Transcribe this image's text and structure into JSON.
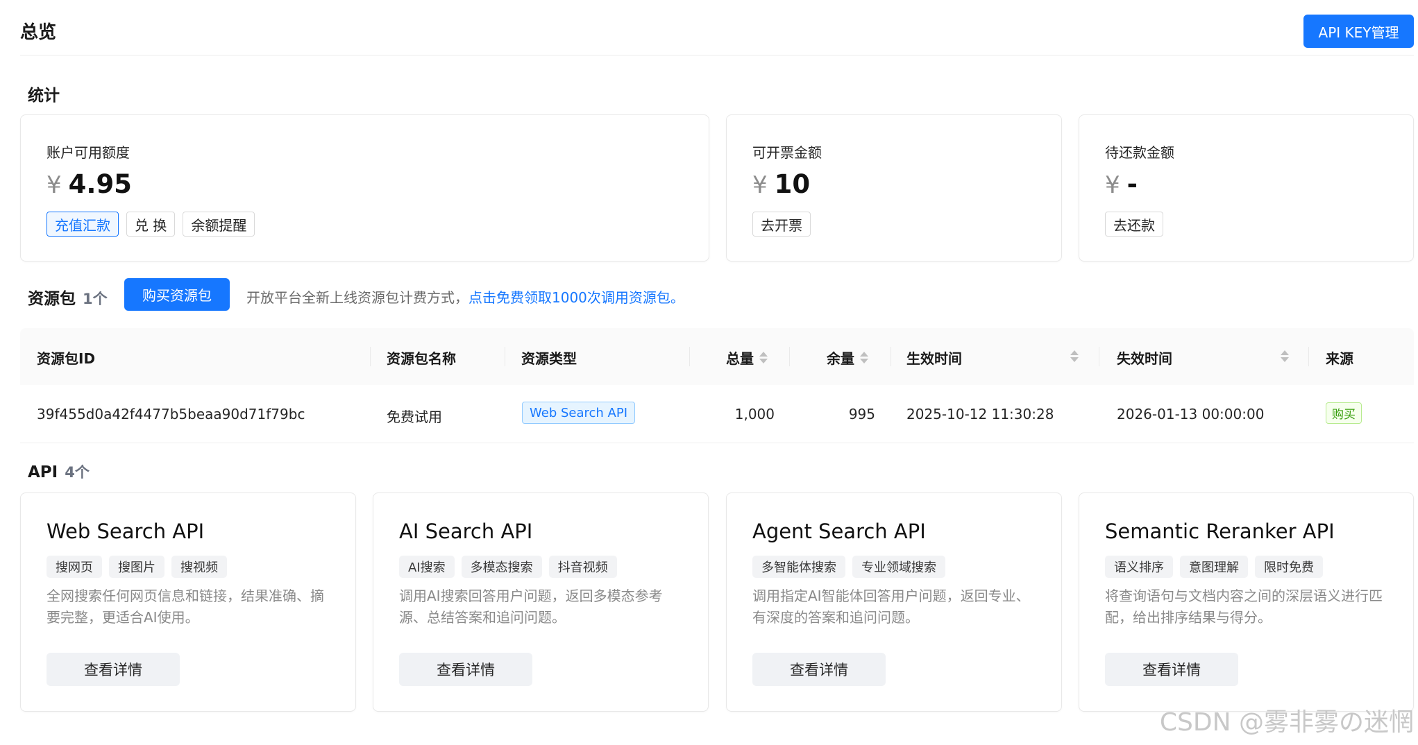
{
  "header": {
    "title": "总览",
    "api_key_button": "API KEY管理"
  },
  "stats": {
    "title": "统计",
    "cards": [
      {
        "label": "账户可用额度",
        "currency": "¥",
        "value": "4.95",
        "actions": [
          "充值汇款",
          "兑 换",
          "余额提醒"
        ]
      },
      {
        "label": "可开票金额",
        "currency": "¥",
        "value": "10",
        "actions": [
          "去开票"
        ]
      },
      {
        "label": "待还款金额",
        "currency": "¥",
        "value": "-",
        "actions": [
          "去还款"
        ]
      }
    ]
  },
  "resources": {
    "title": "资源包",
    "count": "1个",
    "buy_button": "购买资源包",
    "promo_text": "开放平台全新上线资源包计费方式，",
    "promo_link": "点击免费领取1000次调用资源包。",
    "columns": [
      "资源包ID",
      "资源包名称",
      "资源类型",
      "总量",
      "余量",
      "生效时间",
      "失效时间",
      "来源"
    ],
    "rows": [
      {
        "id": "39f455d0a42f4477b5beaa90d71f79bc",
        "name": "免费试用",
        "type": "Web Search API",
        "total": "1,000",
        "remaining": "995",
        "start": "2025-10-12 11:30:28",
        "end": "2026-01-13 00:00:00",
        "source": "购买"
      }
    ]
  },
  "apis": {
    "title": "API",
    "count": "4个",
    "detail_label": "查看详情",
    "cards": [
      {
        "name": "Web Search API",
        "tags": [
          "搜网页",
          "搜图片",
          "搜视频"
        ],
        "desc": "全网搜索任何网页信息和链接，结果准确、摘要完整，更适合AI使用。"
      },
      {
        "name": "AI Search API",
        "tags": [
          "AI搜索",
          "多模态搜索",
          "抖音视频"
        ],
        "desc": "调用AI搜索回答用户问题，返回多模态参考源、总结答案和追问问题。"
      },
      {
        "name": "Agent Search API",
        "tags": [
          "多智能体搜索",
          "专业领域搜索"
        ],
        "desc": "调用指定AI智能体回答用户问题，返回专业、有深度的答案和追问问题。"
      },
      {
        "name": "Semantic Reranker API",
        "tags": [
          "语义排序",
          "意图理解",
          "限时免费"
        ],
        "desc": "将查询语句与文档内容之间的深层语义进行匹配，给出排序结果与得分。"
      }
    ]
  },
  "watermark": "CSDN @雾非雾の迷惘",
  "colors": {
    "primary": "#1677ff",
    "success": "#389e0d",
    "muted": "#8a8a8a"
  }
}
